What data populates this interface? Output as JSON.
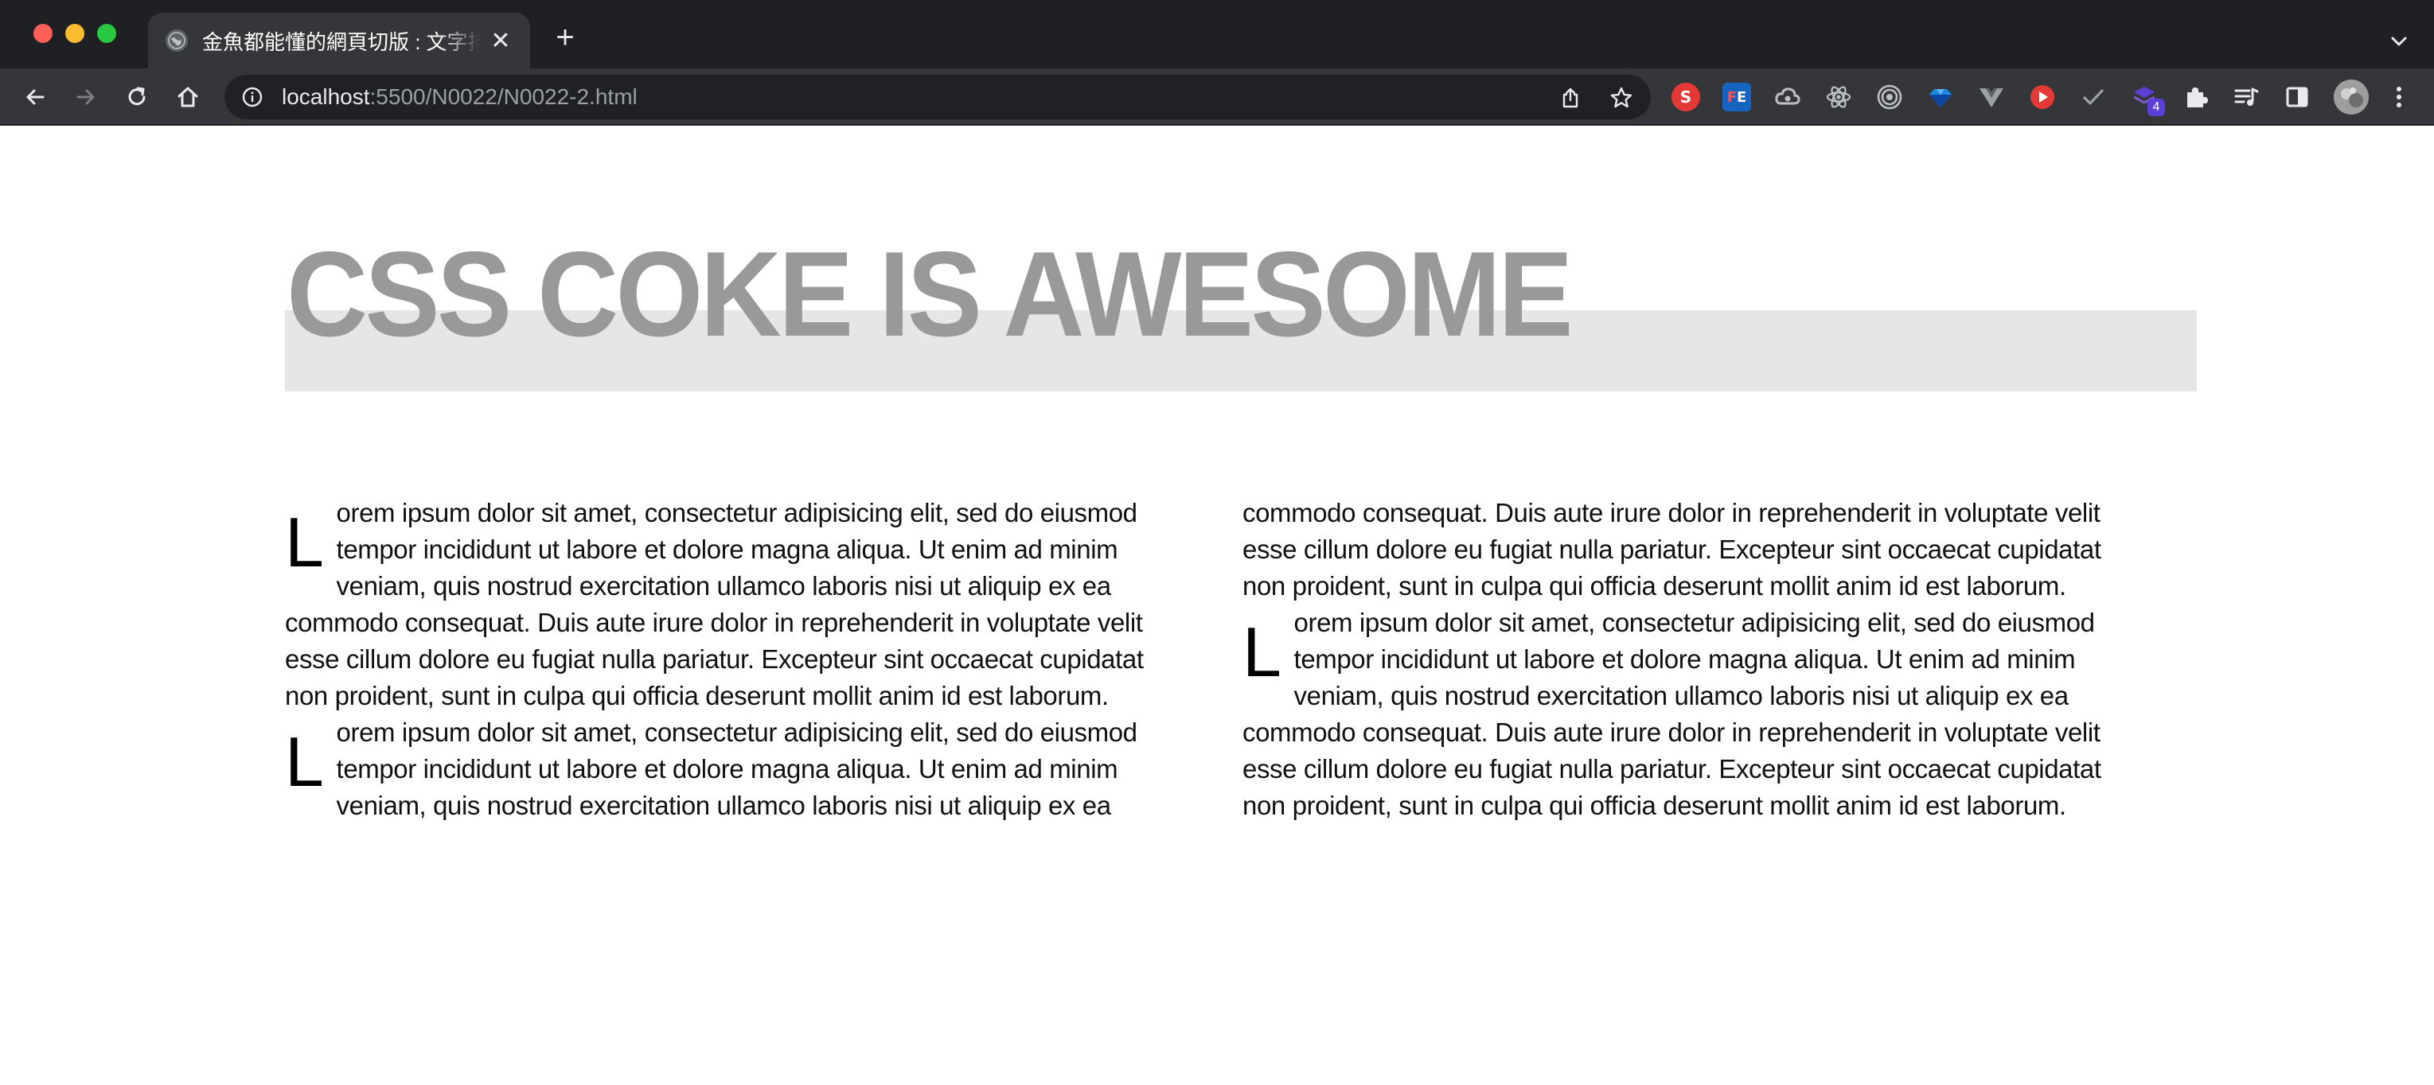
{
  "browser": {
    "tab": {
      "title": "金魚都能懂的網頁切版 : 文字排版",
      "close_glyph": "✕"
    },
    "new_tab_glyph": "+",
    "address": {
      "host": "localhost",
      "path": ":5500/N0022/N0022-2.html"
    },
    "extensions": [
      {
        "name": "s-extension-icon",
        "label": "S",
        "color": "#e53935"
      },
      {
        "name": "fe-extension-icon",
        "label": "FE",
        "color": "#d32f2f"
      },
      {
        "name": "cloud-extension-icon",
        "label": "",
        "color": "#9aa0a6"
      },
      {
        "name": "react-devtools-icon",
        "label": "",
        "color": "#9aa0a6"
      },
      {
        "name": "target-extension-icon",
        "label": "",
        "color": "#9aa0a6"
      },
      {
        "name": "gem-extension-icon",
        "label": "",
        "color": "#2962ff"
      },
      {
        "name": "vue-devtools-icon",
        "label": "",
        "color": "#9aa0a6"
      },
      {
        "name": "play-extension-icon",
        "label": "",
        "color": "#e53935"
      },
      {
        "name": "check-extension-icon",
        "label": "",
        "color": "#9aa0a6"
      },
      {
        "name": "stack-extension-icon",
        "label": "4",
        "color": "#5b3fd8"
      }
    ]
  },
  "page": {
    "headline": "CSS COKE IS AWESOME",
    "paragraphs": [
      {
        "dropcap": "L",
        "text": "orem ipsum dolor sit amet, consectetur adipisicing elit, sed do eiusmod tempor incididunt ut labore et dolore magna aliqua. Ut enim ad minim veniam, quis nostrud exercitation ullamco laboris nisi ut aliquip ex ea commodo consequat. Duis aute irure dolor in reprehenderit in voluptate velit esse cillum dolore eu fugiat nulla pariatur. Excepteur sint occaecat cupidatat non proident, sunt in culpa qui officia deserunt mollit anim id est laborum."
      },
      {
        "dropcap": "L",
        "text": "orem ipsum dolor sit amet, consectetur adipisicing elit, sed do eiusmod tempor incididunt ut labore et dolore magna aliqua. Ut enim ad minim veniam, quis nostrud exercitation ullamco laboris nisi ut aliquip ex ea commodo consequat. Duis aute irure dolor in reprehenderit in voluptate velit esse cillum dolore eu fugiat nulla pariatur. Excepteur sint occaecat cupidatat non proident, sunt in culpa qui officia deserunt mollit anim id est laborum."
      },
      {
        "dropcap": "L",
        "text": "orem ipsum dolor sit amet, consectetur adipisicing elit, sed do eiusmod tempor incididunt ut labore et dolore magna aliqua. Ut enim ad minim veniam, quis nostrud exercitation ullamco laboris nisi ut aliquip ex ea commodo consequat. Duis aute irure dolor in reprehenderit in voluptate velit esse cillum dolore eu fugiat nulla pariatur. Excepteur sint occaecat cupidatat non proident, sunt in culpa qui officia deserunt mollit anim id est laborum."
      }
    ]
  },
  "colors": {
    "headline": "#999999",
    "headline_bar": "#e6e6e6",
    "chrome_dark": "#1f2023",
    "chrome_toolbar": "#35363a"
  }
}
